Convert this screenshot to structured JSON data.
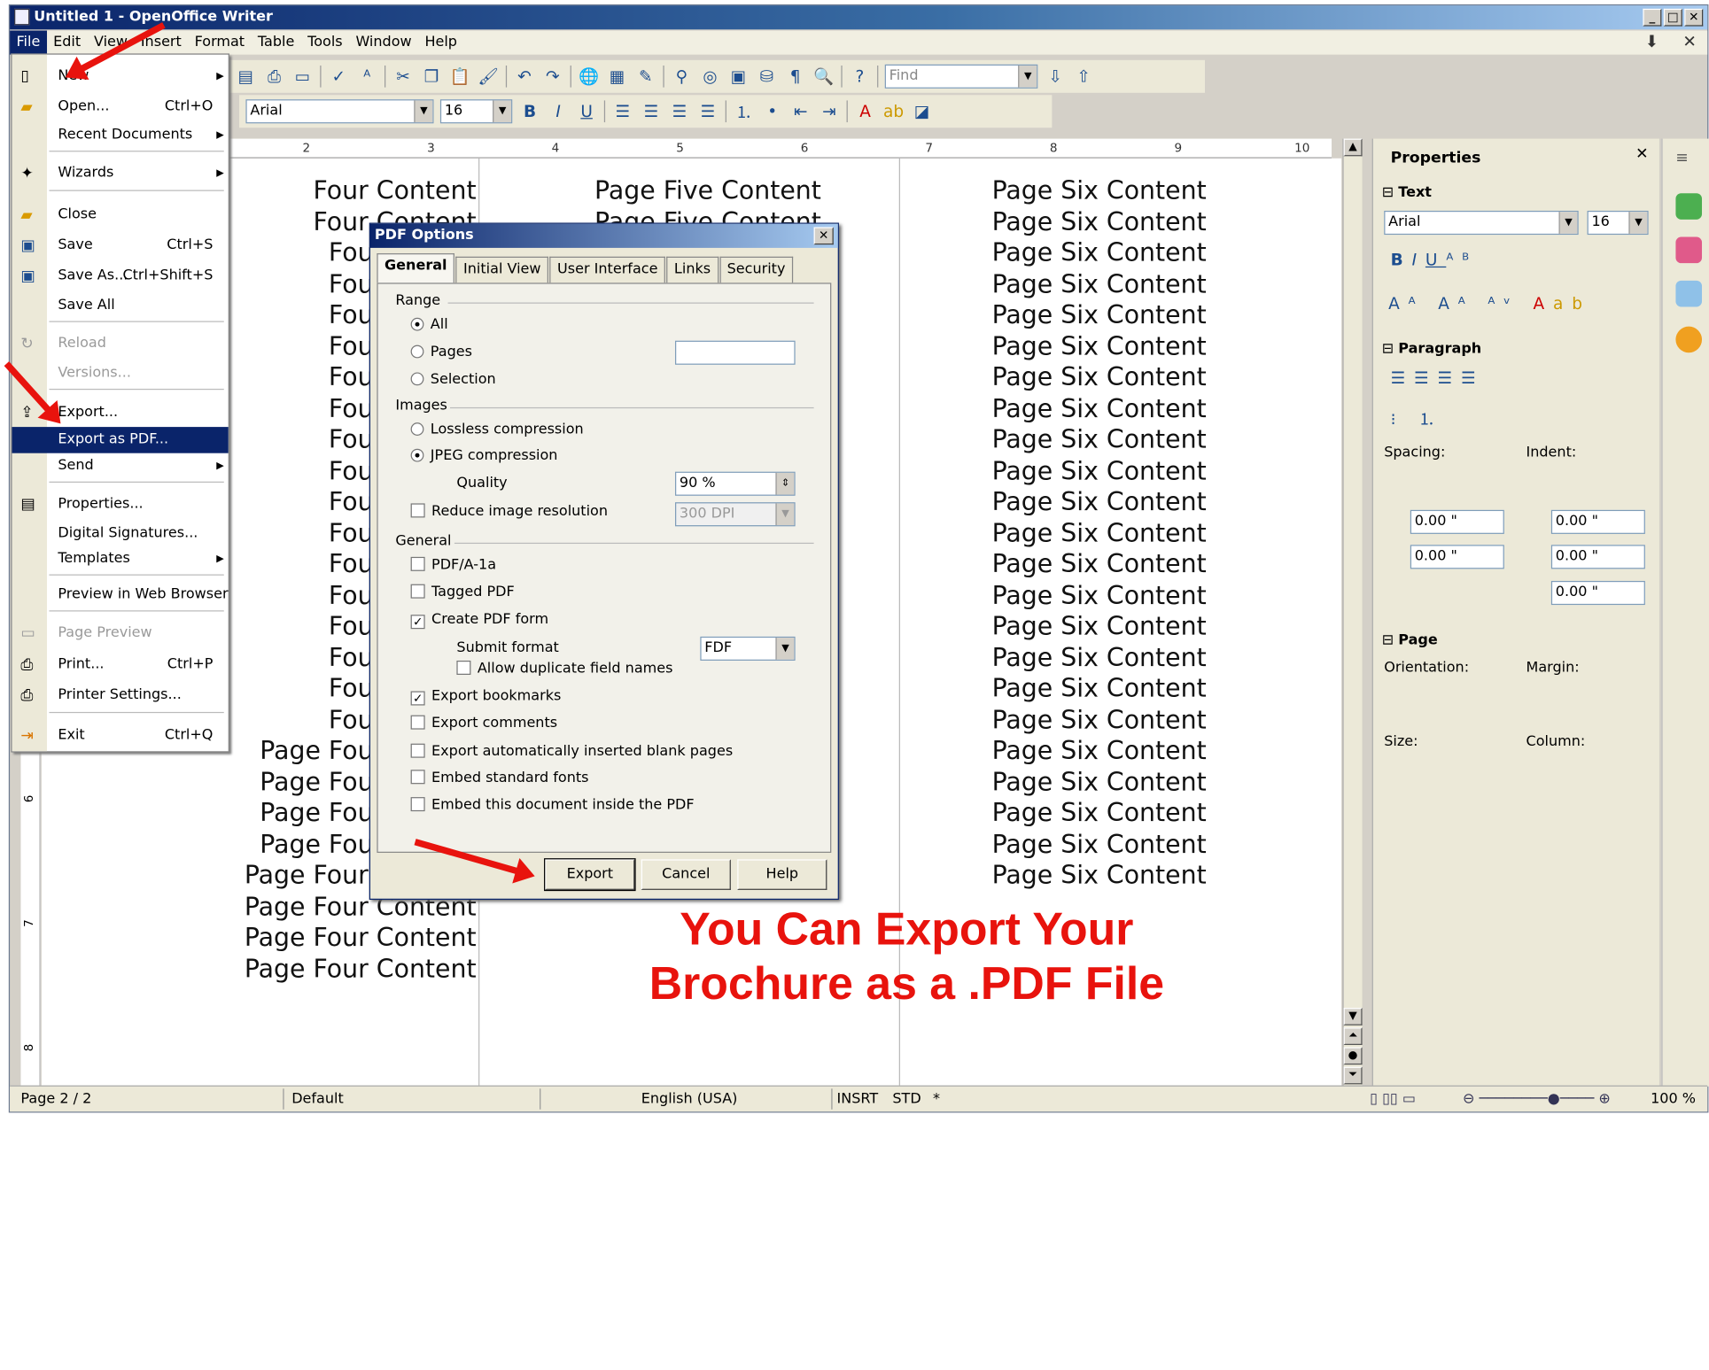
{
  "window": {
    "title": "Untitled 1 - OpenOffice Writer",
    "min": "_",
    "max": "□",
    "close": "✕"
  },
  "menubar": [
    "File",
    "Edit",
    "View",
    "Insert",
    "Format",
    "Table",
    "Tools",
    "Window",
    "Help"
  ],
  "toolbar": {
    "find_placeholder": "Find",
    "font_name": "Arial",
    "font_size": "16"
  },
  "ruler": {
    "h": [
      "2",
      "3",
      "4",
      "5",
      "6",
      "7",
      "8",
      "9",
      "10"
    ],
    "v": [
      "6",
      "7",
      "8"
    ]
  },
  "document": {
    "col1": [
      "Four Content",
      "Four Content",
      "Four Conter",
      "Four Conter",
      "Four Conter",
      "Four Conter",
      "Four Conter",
      "Four Conter",
      "Four Conter",
      "Four Conter",
      "Four Conter",
      "Four Conter",
      "Four Conter",
      "Four Conter",
      "Four Conter",
      "Four Conter",
      "Four Conter",
      "Four Conter",
      "Page Four Conter",
      "Page Four Conter",
      "Page Four Conter",
      "Page Four Conter",
      "Page Four Content",
      "Page Four Content",
      "Page Four Content",
      "Page Four Content"
    ],
    "col2": [
      "Page Five Content",
      "Page Five Content"
    ],
    "col3": [
      "Page Six Content",
      "Page Six Content",
      "Page Six Content",
      "Page Six Content",
      "Page Six Content",
      "Page Six Content",
      "Page Six Content",
      "Page Six Content",
      "Page Six Content",
      "Page Six Content",
      "Page Six Content",
      "Page Six Content",
      "Page Six Content",
      "Page Six Content",
      "Page Six Content",
      "Page Six Content",
      "Page Six Content",
      "Page Six Content",
      "Page Six Content",
      "Page Six Content",
      "Page Six Content",
      "Page Six Content",
      "Page Six Content"
    ]
  },
  "file_menu": {
    "new": "New",
    "open": "Open...",
    "open_sc": "Ctrl+O",
    "recent": "Recent Documents",
    "wizards": "Wizards",
    "close": "Close",
    "save": "Save",
    "save_sc": "Ctrl+S",
    "save_as": "Save As...",
    "save_as_sc": "Ctrl+Shift+S",
    "save_all": "Save All",
    "reload": "Reload",
    "versions": "Versions...",
    "export": "Export...",
    "export_pdf": "Export as PDF...",
    "send": "Send",
    "properties": "Properties...",
    "signatures": "Digital Signatures...",
    "templates": "Templates",
    "preview_web": "Preview in Web Browser",
    "page_preview": "Page Preview",
    "print": "Print...",
    "print_sc": "Ctrl+P",
    "printer_settings": "Printer Settings...",
    "exit": "Exit",
    "exit_sc": "Ctrl+Q"
  },
  "dialog": {
    "title": "PDF Options",
    "tabs": [
      "General",
      "Initial View",
      "User Interface",
      "Links",
      "Security"
    ],
    "range": {
      "label": "Range",
      "all": "All",
      "pages": "Pages",
      "selection": "Selection"
    },
    "images": {
      "label": "Images",
      "lossless": "Lossless compression",
      "jpeg": "JPEG compression",
      "quality_label": "Quality",
      "quality": "90 %",
      "reduce": "Reduce image resolution",
      "dpi": "300 DPI"
    },
    "general": {
      "label": "General",
      "pdfa": "PDF/A-1a",
      "tagged": "Tagged PDF",
      "form": "Create PDF form",
      "submit_label": "Submit format",
      "submit": "FDF",
      "duplicate": "Allow duplicate field names",
      "bookmarks": "Export bookmarks",
      "comments": "Export comments",
      "blank": "Export automatically inserted blank pages",
      "fonts": "Embed standard fonts",
      "embed": "Embed this document inside the PDF"
    },
    "buttons": {
      "export": "Export",
      "cancel": "Cancel",
      "help": "Help"
    }
  },
  "sidebar": {
    "title": "Properties",
    "text_section": "Text",
    "font_name": "Arial",
    "font_size": "16",
    "paragraph_section": "Paragraph",
    "spacing": "Spacing:",
    "indent": "Indent:",
    "sp_above": "0.00 \"",
    "sp_below": "0.00 \"",
    "in_before": "0.00 \"",
    "in_after": "0.00 \"",
    "in_first": "0.00 \"",
    "page_section": "Page",
    "orientation": "Orientation:",
    "margin": "Margin:",
    "size": "Size:",
    "column": "Column:"
  },
  "statusbar": {
    "page": "Page 2 / 2",
    "style": "Default",
    "language": "English (USA)",
    "mode": "INSRT",
    "sel": "STD",
    "modified": "*",
    "zoom": "100 %"
  },
  "overlay": {
    "line1": "You Can Export Your",
    "line2": "Brochure as a .PDF File"
  },
  "colors": {
    "annotation_red": "#e8130d",
    "highlight": "#0a246a"
  }
}
